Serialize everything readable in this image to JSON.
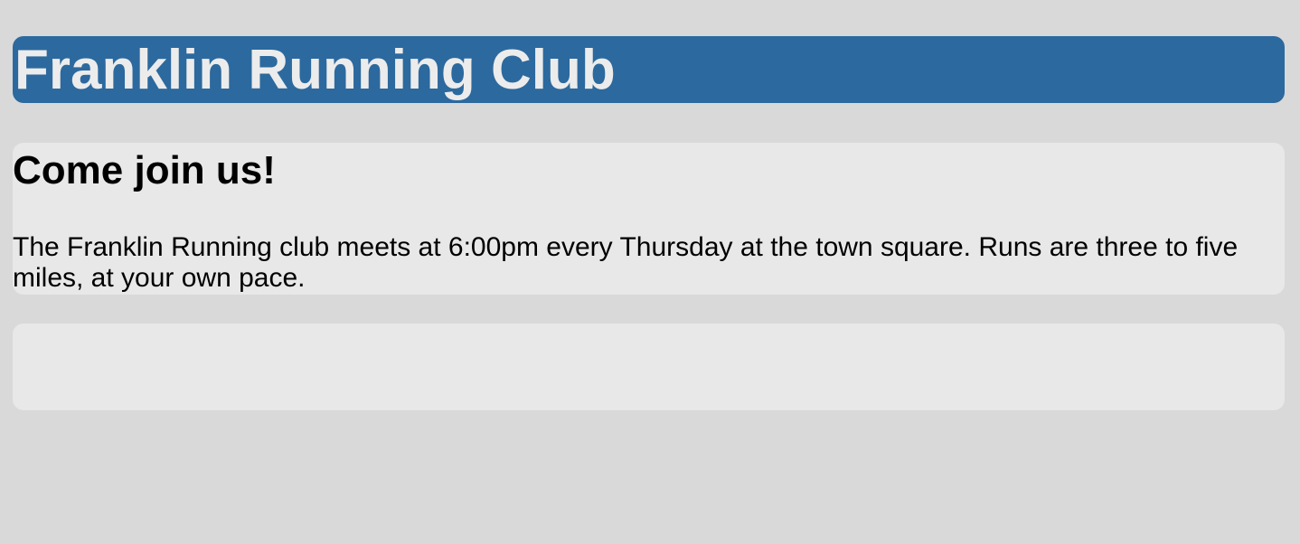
{
  "header": {
    "title": "Franklin Running Club"
  },
  "intro": {
    "heading": "Come join us!",
    "body": "The Franklin Running club meets at 6:00pm every Thursday at the town square. Runs are three to five miles, at your own pace."
  },
  "colors": {
    "page_background": "#d9d9d9",
    "header_background": "#2c699e",
    "header_text": "#ececec",
    "card_background": "#e8e8e8"
  }
}
